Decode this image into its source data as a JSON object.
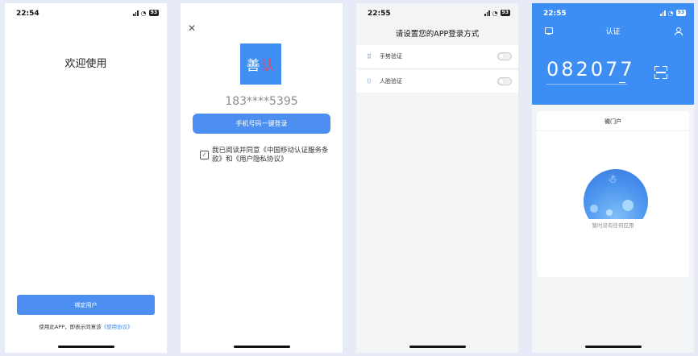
{
  "screen1": {
    "time": "22:54",
    "battery": "93",
    "title": "欢迎使用",
    "bind_button": "绑定用户",
    "agreement_prefix": "使用此APP，即表示同意该",
    "agreement_link": "《使用协议》"
  },
  "screen2": {
    "logo_text_1": "善",
    "logo_text_2": "认",
    "phone_masked": "183****5395",
    "login_button": "手机号码一键登录",
    "agreement_text": "我已阅读并同意《中国移动认证服务条款》和《用户隐私协议》"
  },
  "screen3": {
    "time": "22:55",
    "battery": "93",
    "title": "请设置您的APP登录方式",
    "options": [
      {
        "label": "手势验证",
        "icon": "gesture-grid-icon",
        "enabled": false
      },
      {
        "label": "人脸验证",
        "icon": "face-scan-icon",
        "enabled": false
      }
    ]
  },
  "screen4": {
    "time": "22:55",
    "battery": "93",
    "title": "认证",
    "code": "082077",
    "tab": "微门户",
    "empty_text": "暂时没有任何应用"
  },
  "colors": {
    "accent": "#4c8ff0",
    "header_blue": "#3c8ef4",
    "background": "#e7ebf8"
  }
}
